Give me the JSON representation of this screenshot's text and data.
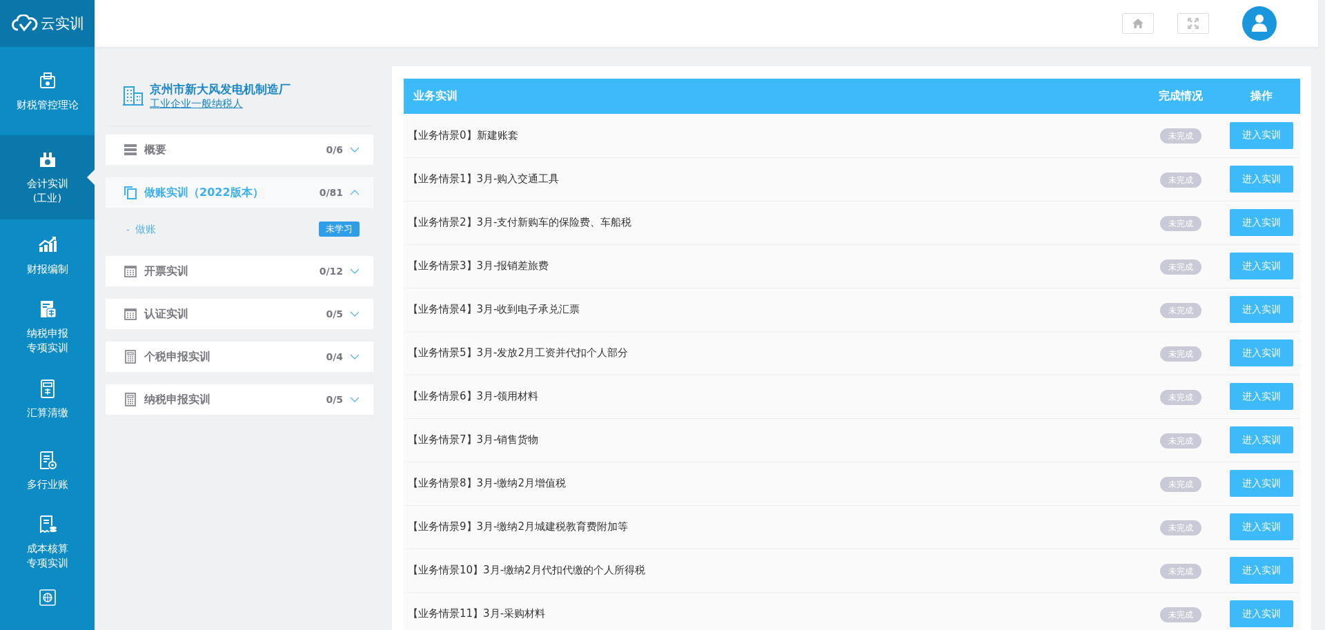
{
  "logo": {
    "text": "云实训"
  },
  "sidebar": {
    "items": [
      {
        "kind": "bag",
        "lines": [
          "财税管控理论"
        ],
        "selected": false
      },
      {
        "kind": "factory",
        "lines": [
          "会计实训",
          "(工业)"
        ],
        "selected": true
      },
      {
        "kind": "chart",
        "lines": [
          "财报编制"
        ],
        "selected": false
      },
      {
        "kind": "taxdoc",
        "lines": [
          "纳税申报",
          "专项实训"
        ],
        "selected": false
      },
      {
        "kind": "taxcalc",
        "lines": [
          "汇算清缴"
        ],
        "selected": false
      },
      {
        "kind": "docgear",
        "lines": [
          "多行业账"
        ],
        "selected": false
      },
      {
        "kind": "receipt",
        "lines": [
          "成本核算",
          "专项实训"
        ],
        "selected": false
      },
      {
        "kind": "globe",
        "selected": false
      }
    ]
  },
  "company": {
    "name": "京州市新大风发电机制造厂",
    "type": "工业企业一般纳税人"
  },
  "sections": [
    {
      "kind": "list",
      "title": "概要",
      "count": "0/6",
      "expanded": false
    },
    {
      "kind": "copy",
      "title": "做账实训（2022版本）",
      "count": "0/81",
      "expanded": true,
      "children": [
        {
          "marker": "-",
          "label": "做账",
          "badge": "未学习"
        }
      ]
    },
    {
      "kind": "calendar",
      "title": "开票实训",
      "count": "0/12",
      "expanded": false
    },
    {
      "kind": "calendar",
      "title": "认证实训",
      "count": "0/5",
      "expanded": false
    },
    {
      "kind": "calc",
      "title": "个税申报实训",
      "count": "0/4",
      "expanded": false
    },
    {
      "kind": "calc",
      "title": "纳税申报实训",
      "count": "0/5",
      "expanded": false
    }
  ],
  "table": {
    "columns": [
      "业务实训",
      "完成情况",
      "操作"
    ],
    "rows": [
      {
        "title": "【业务情景0】新建账套",
        "status": "未完成",
        "action": "进入实训"
      },
      {
        "title": "【业务情景1】3月-购入交通工具",
        "status": "未完成",
        "action": "进入实训"
      },
      {
        "title": "【业务情景2】3月-支付新购车的保险费、车船税",
        "status": "未完成",
        "action": "进入实训"
      },
      {
        "title": "【业务情景3】3月-报销差旅费",
        "status": "未完成",
        "action": "进入实训"
      },
      {
        "title": "【业务情景4】3月-收到电子承兑汇票",
        "status": "未完成",
        "action": "进入实训"
      },
      {
        "title": "【业务情景5】3月-发放2月工资并代扣个人部分",
        "status": "未完成",
        "action": "进入实训"
      },
      {
        "title": "【业务情景6】3月-领用材料",
        "status": "未完成",
        "action": "进入实训"
      },
      {
        "title": "【业务情景7】3月-销售货物",
        "status": "未完成",
        "action": "进入实训"
      },
      {
        "title": "【业务情景8】3月-缴纳2月增值税",
        "status": "未完成",
        "action": "进入实训"
      },
      {
        "title": "【业务情景9】3月-缴纳2月城建税教育费附加等",
        "status": "未完成",
        "action": "进入实训"
      },
      {
        "title": "【业务情景10】3月-缴纳2月代扣代缴的个人所得税",
        "status": "未完成",
        "action": "进入实训"
      },
      {
        "title": "【业务情景11】3月-采购材料",
        "status": "未完成",
        "action": "进入实训"
      }
    ]
  }
}
